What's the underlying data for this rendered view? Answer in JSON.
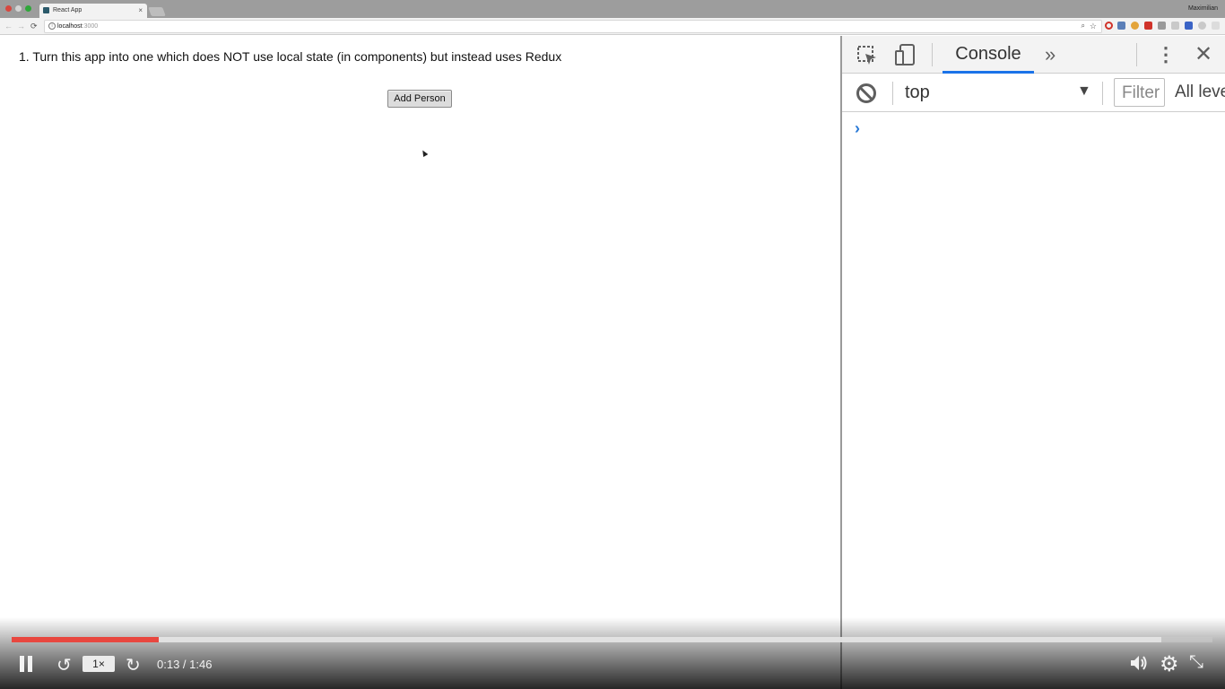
{
  "browser": {
    "tab_title": "React App",
    "tab_close": "×",
    "profile_name": "Maximilian",
    "nav_back": "←",
    "nav_forward": "→",
    "nav_reload": "⟳",
    "url_host": "localhost",
    "url_port": ":3000",
    "url_info_icon": "i",
    "zoom_icon": "⌕",
    "star_icon": "☆"
  },
  "page": {
    "task_text": "1. Turn this app into one which does NOT use local state (in components) but instead uses Redux",
    "add_button_label": "Add Person"
  },
  "devtools": {
    "more_tabs": "»",
    "active_tab": "Console",
    "menu_icon": "⋮",
    "close_icon": "✕",
    "context_value": "top",
    "context_arrow": "▼",
    "filter_placeholder": "Filter",
    "levels_label": "All levels",
    "prompt_symbol": "›"
  },
  "player": {
    "current_time": "0:13",
    "duration": "1:46",
    "time_display": "0:13 / 1:46",
    "speed": "1×",
    "progress_fraction": 0.1227,
    "buffered_fraction": 0.9574,
    "rewind_icon": "↺",
    "forward_icon": "↻",
    "settings_icon": "⚙",
    "exit_fullscreen_icon": "⤡",
    "accent_color": "#e8473f"
  }
}
